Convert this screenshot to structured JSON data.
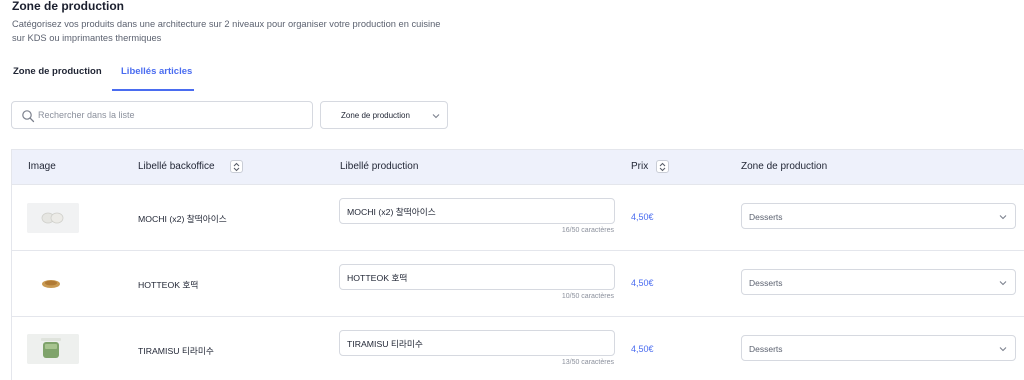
{
  "header": {
    "title": "Zone de production",
    "subtitle": "Catégorisez vos produits dans une architecture sur 2 niveaux pour organiser votre production en cuisine sur KDS ou imprimantes thermiques"
  },
  "tabs": [
    {
      "label": "Zone de production",
      "active": false
    },
    {
      "label": "Libellés articles",
      "active": true
    }
  ],
  "search": {
    "placeholder": "Rechercher dans la liste",
    "value": ""
  },
  "filter": {
    "label": "Zone de production"
  },
  "table": {
    "columns": {
      "image": "Image",
      "libelle_backoffice": "Libellé backoffice",
      "libelle_production": "Libellé production",
      "prix": "Prix",
      "zone": "Zone de production"
    },
    "rows": [
      {
        "libelle": "MOCHI (x2) 찰떡아이스",
        "production": "MOCHI (x2) 찰떡아이스",
        "counter": "16/50 caractères",
        "price": "4,50€",
        "zone": "Desserts",
        "image": "mochi"
      },
      {
        "libelle": "HOTTEOK 호떡",
        "production": "HOTTEOK 호떡",
        "counter": "10/50 caractères",
        "price": "4,50€",
        "zone": "Desserts",
        "image": "hotteok"
      },
      {
        "libelle": "TIRAMISU 티라미수",
        "production": "TIRAMISU 티라미수",
        "counter": "13/50 caractères",
        "price": "4,50€",
        "zone": "Desserts",
        "image": "tiramisu"
      }
    ]
  },
  "colors": {
    "accent": "#4a6cf0",
    "header_bg": "#eef1fb",
    "border": "#d6d9e0",
    "text": "#1f2433",
    "muted": "#8b909c"
  },
  "icons": [
    "search-icon",
    "chevron-down-icon",
    "sort-icon"
  ]
}
